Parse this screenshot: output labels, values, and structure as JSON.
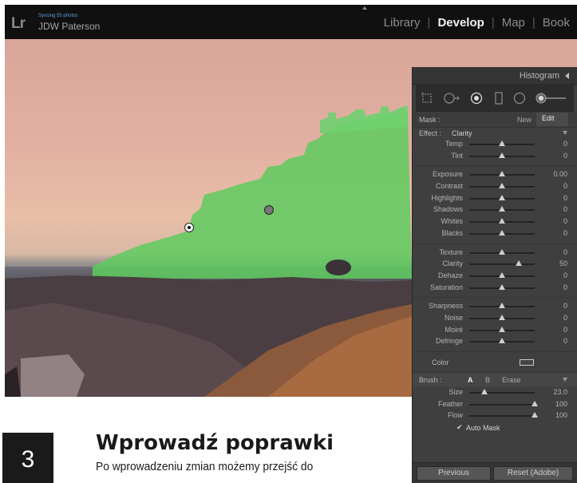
{
  "app": {
    "logo": "Lr",
    "sync_status": "Syncing 55 photos",
    "user_name": "JDW Paterson",
    "modules": [
      {
        "label": "Library",
        "active": false
      },
      {
        "label": "Develop",
        "active": true
      },
      {
        "label": "Map",
        "active": false
      },
      {
        "label": "Book",
        "active": false
      }
    ]
  },
  "panel": {
    "title": "Histogram",
    "tools": [
      "crop-overlay-icon",
      "spot-removal-icon",
      "red-eye-icon",
      "graduated-filter-icon",
      "radial-filter-icon",
      "adjustment-brush-icon"
    ],
    "mask": {
      "label": "Mask :",
      "new": "New",
      "edit": "Edit"
    },
    "effect": {
      "label": "Effect :",
      "value": "Clarity"
    },
    "groups": [
      [
        {
          "label": "Temp",
          "value": "0",
          "pos": 0.5
        },
        {
          "label": "Tint",
          "value": "0",
          "pos": 0.5
        }
      ],
      [
        {
          "label": "Exposure",
          "value": "0.00",
          "pos": 0.5
        },
        {
          "label": "Contrast",
          "value": "0",
          "pos": 0.5
        },
        {
          "label": "Highlights",
          "value": "0",
          "pos": 0.5
        },
        {
          "label": "Shadows",
          "value": "0",
          "pos": 0.5
        },
        {
          "label": "Whites",
          "value": "0",
          "pos": 0.5
        },
        {
          "label": "Blacks",
          "value": "0",
          "pos": 0.5
        }
      ],
      [
        {
          "label": "Texture",
          "value": "0",
          "pos": 0.5
        },
        {
          "label": "Clarity",
          "value": "50",
          "pos": 0.75
        },
        {
          "label": "Dehaze",
          "value": "0",
          "pos": 0.5
        },
        {
          "label": "Saturation",
          "value": "0",
          "pos": 0.5
        }
      ],
      [
        {
          "label": "Sharpness",
          "value": "0",
          "pos": 0.5
        },
        {
          "label": "Noise",
          "value": "0",
          "pos": 0.5
        },
        {
          "label": "Moiré",
          "value": "0",
          "pos": 0.5
        },
        {
          "label": "Defringe",
          "value": "0",
          "pos": 0.5
        }
      ]
    ],
    "color_label": "Color",
    "brush": {
      "label": "Brush :",
      "a": "A",
      "b": "B",
      "erase": "Erase"
    },
    "brush_sliders": [
      {
        "label": "Size",
        "value": "23.0",
        "pos": 0.23
      },
      {
        "label": "Feather",
        "value": "100",
        "pos": 1.0
      },
      {
        "label": "Flow",
        "value": "100",
        "pos": 1.0
      }
    ],
    "auto_mask": {
      "label": "Auto Mask",
      "checked": true
    },
    "buttons": {
      "previous": "Previous",
      "reset": "Reset (Adobe)"
    }
  },
  "step": {
    "number": "3",
    "title": "Wprowadź poprawki",
    "text": "Po wprowadzeniu zmian możemy przejść do"
  },
  "colors": {
    "mask_overlay": "#5ecb5e",
    "panel_bg": "#3f3f3f",
    "accent_text": "#5fa0d8"
  }
}
